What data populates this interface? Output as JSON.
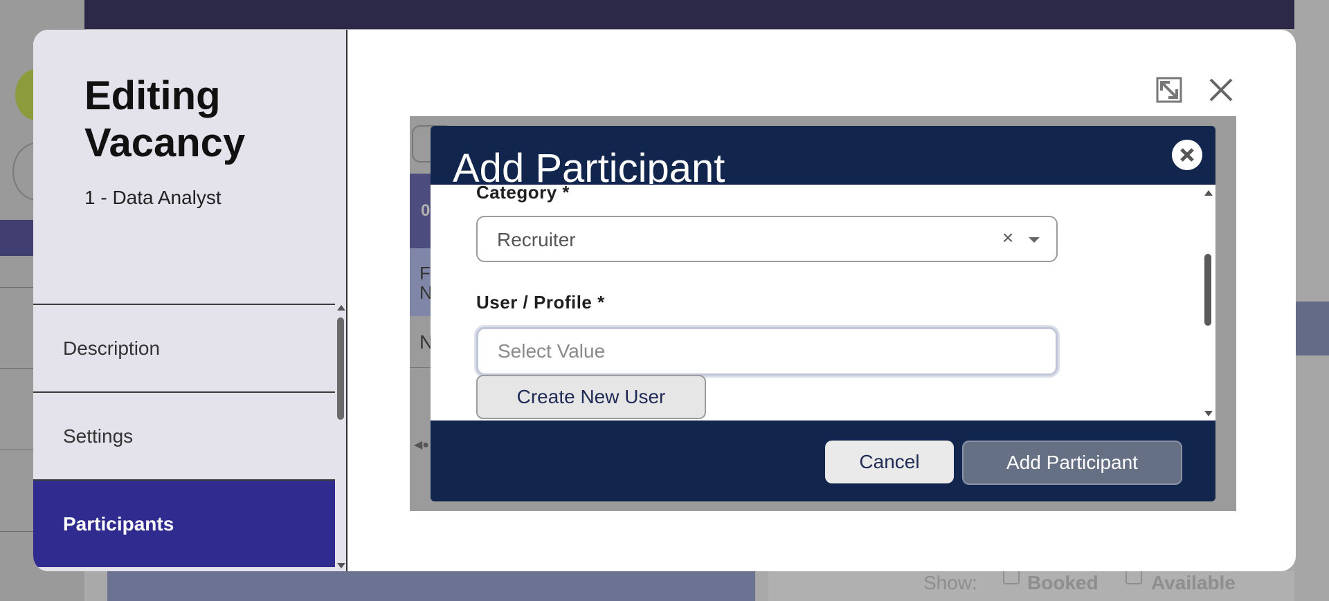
{
  "background": {
    "show_label": "Show:",
    "filters": [
      {
        "label": "Booked",
        "checked": true
      },
      {
        "label": "Available",
        "checked": true
      }
    ],
    "inner_row_letters": [
      "0",
      "F\nN",
      "N"
    ]
  },
  "editor": {
    "title": "Editing Vacancy",
    "subtitle": "1 - Data Analyst",
    "nav_items": [
      {
        "label": "Description",
        "active": false
      },
      {
        "label": "Settings",
        "active": false
      },
      {
        "label": "Participants",
        "active": true
      }
    ],
    "expand_icon": "expand-icon",
    "close_icon": "close-icon"
  },
  "dialog": {
    "title": "Add Participant",
    "close_icon": "close-icon",
    "category_label": "Category *",
    "category_value": "Recruiter",
    "category_clear": "×",
    "user_label": "User / Profile *",
    "user_placeholder": "Select Value",
    "user_value": "",
    "create_user_label": "Create New User",
    "cancel_label": "Cancel",
    "add_label": "Add Participant"
  },
  "colors": {
    "dialog_header": "#12254d",
    "nav_active": "#302c8f",
    "add_button": "#667085"
  }
}
